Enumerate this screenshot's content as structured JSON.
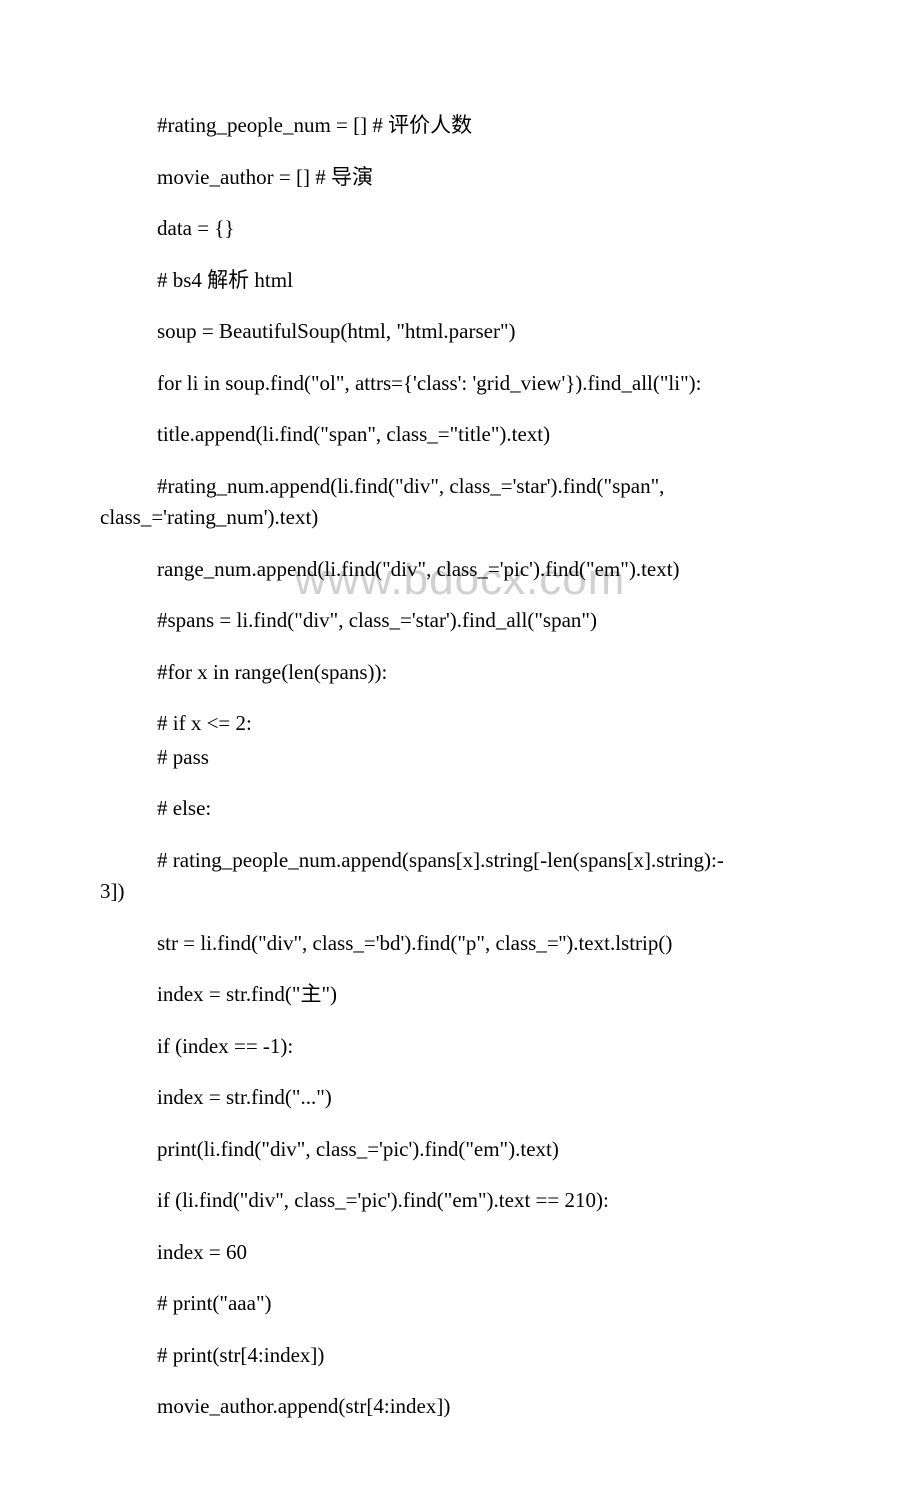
{
  "watermark": "www.bdocx.com",
  "lines": [
    {
      "text": "#rating_people_num = [] # 评价人数",
      "indent": 1
    },
    {
      "text": "movie_author = [] # 导演",
      "indent": 1
    },
    {
      "text": "data = {}",
      "indent": 1
    },
    {
      "text": "# bs4 解析 html",
      "indent": 1
    },
    {
      "text": "soup = BeautifulSoup(html, \"html.parser\")",
      "indent": 1
    },
    {
      "text": "for li in soup.find(\"ol\", attrs={'class': 'grid_view'}).find_all(\"li\"):",
      "indent": 1
    },
    {
      "text": "title.append(li.find(\"span\", class_=\"title\").text)",
      "indent": 1
    },
    {
      "text": "#rating_num.append(li.find(\"div\", class_='star').find(\"span\", class_='rating_num').text)",
      "indent": 1,
      "wrap": true
    },
    {
      "text": "range_num.append(li.find(\"div\", class_='pic').find(\"em\").text)",
      "indent": 1
    },
    {
      "text": "#spans = li.find(\"div\", class_='star').find_all(\"span\")",
      "indent": 1
    },
    {
      "text": "#for x in range(len(spans)):",
      "indent": 1
    },
    {
      "text": "# if x <= 2:",
      "indent": 1
    },
    {
      "text": "# pass",
      "indent": 1,
      "nomargin": true
    },
    {
      "text": "# else:",
      "indent": 1
    },
    {
      "text": "# rating_people_num.append(spans[x].string[-len(spans[x].string):-3])",
      "indent": 1,
      "wrap": true
    },
    {
      "text": "str = li.find(\"div\", class_='bd').find(\"p\", class_='').text.lstrip()",
      "indent": 1
    },
    {
      "text": "index = str.find(\"主\")",
      "indent": 1
    },
    {
      "text": "if (index == -1):",
      "indent": 1
    },
    {
      "text": "index = str.find(\"...\")",
      "indent": 1
    },
    {
      "text": "print(li.find(\"div\", class_='pic').find(\"em\").text)",
      "indent": 1
    },
    {
      "text": "if (li.find(\"div\", class_='pic').find(\"em\").text == 210):",
      "indent": 1
    },
    {
      "text": "index = 60",
      "indent": 1
    },
    {
      "text": "# print(\"aaa\")",
      "indent": 1
    },
    {
      "text": "# print(str[4:index])",
      "indent": 1
    },
    {
      "text": "movie_author.append(str[4:index])",
      "indent": 1
    }
  ]
}
